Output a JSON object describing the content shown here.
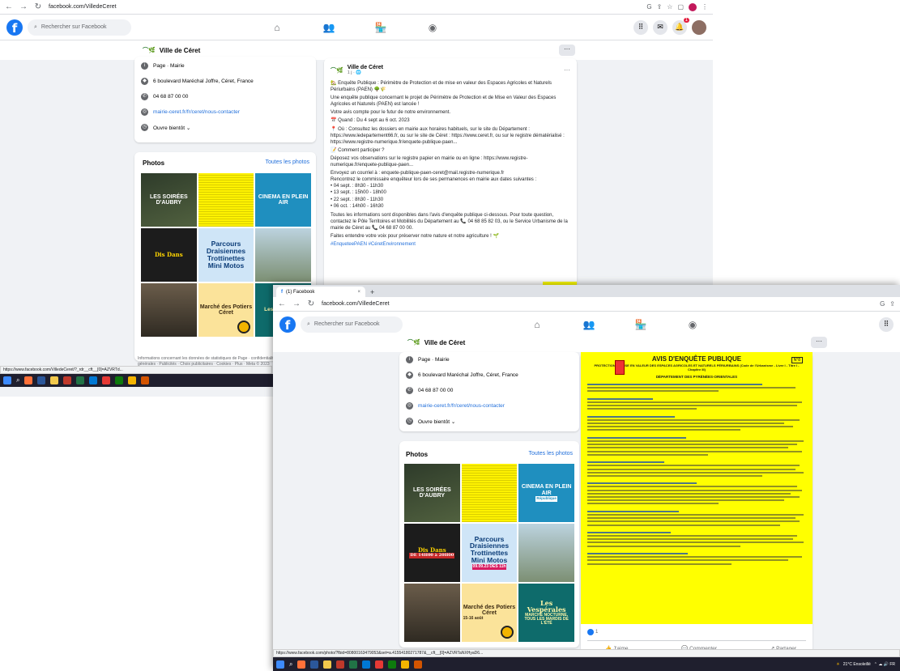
{
  "browser": {
    "url": "facebook.com/VilledeCeret",
    "tab_title": "(1) Facebook",
    "search_placeholder": "Rechercher sur Facebook",
    "new_tab": "+",
    "tab_close": "×"
  },
  "page": {
    "name": "Ville de Céret",
    "more": "···"
  },
  "intro": {
    "category": "Page · Mairie",
    "address": "6 boulevard Maréchal Joffre, Céret, France",
    "phone": "04 68 87 00 00",
    "website": "mairie-ceret.fr/fr/ceret/nous-contacter",
    "hours": "Ouvre bientôt ⌄"
  },
  "photos": {
    "title": "Photos",
    "see_all": "Toutes les photos",
    "tiles": [
      {
        "text": "LES SOIRÉES D'AUBRY",
        "sub": "LES 8 SEPT. 2023"
      },
      {
        "text": "",
        "sub": ""
      },
      {
        "text": "CINEMA EN PLEIN AIR",
        "sub": "République"
      },
      {
        "text": "Dis Dans",
        "sub": "DE 14H00 à 20H00"
      },
      {
        "text": "Parcours Draisiennes Trottinettes Mini Motos",
        "sub": "09.09.23 DES 11h"
      },
      {
        "text": "",
        "sub": ""
      },
      {
        "text": "",
        "sub": ""
      },
      {
        "text": "Marché des Potiers Céret",
        "sub": "15-16 août"
      },
      {
        "text": "Les Vespérales",
        "sub": "MARCHÉ NOCTURNE, TOUS LES MARDIS DE L'ÉTÉ"
      }
    ],
    "footer": "Informations concernant les données de statistiques de Page · confidentialité · Conditions générales · Publicités · Choix publicitaires · Cookies · Plus · Meta © 2023"
  },
  "post": {
    "author": "Ville de Céret",
    "time": "1 j · 🌐",
    "title": "🏡 Enquête Publique : Périmètre de Protection et de mise en valeur des Espaces Agricoles et Naturels Périurbains (PAEN) 🌳🌾",
    "p1": "Une enquête publique concernant le projet de Périmètre de Protection et de Mise en Valeur des Espaces Agricoles et Naturels (PAEN) est lancée !",
    "p2": "Votre avis compte pour le futur de notre environnement.",
    "when": "📅 Quand : Du 4 sept au 6 oct. 2023",
    "where": "📍 Où : Consultez les dossiers en mairie aux horaires habituels, sur le site du Département : https://www.ledepartement66.fr, ou sur le site de Céret : https://www.ceret.fr, ou sur le registre dématérialisé : https://www.registre-numerique.fr/enquete-publique-paen...",
    "how": "📝 Comment participer ?",
    "how1": "Déposez vos observations sur le registre papier en mairie ou en ligne : https://www.registre-numerique.fr/enquete-publique-paen...",
    "how2": "Envoyez un courriel à : enquete-publique-paen-ceret@mail.registre-numerique.fr",
    "how3": "Rencontrez le commissaire enquêteur lors de ses permanences en mairie aux dates suivantes :",
    "dates": [
      "• 04 sept. : 8h30 - 11h30",
      "• 13 sept. : 15h00 - 18h00",
      "• 22 sept. : 8h30 - 11h30",
      "• 06 oct. : 14h00 - 16h30"
    ],
    "p3": "Toutes les informations sont disponibles dans l'avis d'enquête publique ci-dessous. Pour toute question, contactez le Pôle Territoires et Mobilités du Département au 📞 04 68 85 82 03, ou le Service Urbanisme de la mairie de Céret au 📞 04 68 87 00 00.",
    "p4": "Faites entendre votre voix pour préserver notre nature et notre agriculture ! 🌱",
    "hashtags": "#EnqueteePAEN #CéretEnvironnement",
    "reactions": "1",
    "like": "👍 J'aime",
    "comment": "💬 Commenter",
    "share": "↗ Partager"
  },
  "doc": {
    "title": "AVIS D'ENQUÊTE PUBLIQUE",
    "subtitle": "PROTECTION ET MISE EN VALEUR DES ESPACES AGRICOLES ET NATURELS PÉRIURBAINS (Code de l'Urbanisme - Livre I - Titre I - Chapitre III)",
    "heading2": "DÉPARTEMENT DES PYRÉNÉES-ORIENTALES",
    "ref": "N°8"
  },
  "statusbar": {
    "url1": "https://www.facebook.com/VilledeCeret/?_rdr__cft__[0]=AZVRTd...",
    "url2": "https://www.facebook.com/photo/?fbid=80800163479053&set=a.41554180271787&__cft__[0]=AZVRTaNXHyaD6..."
  },
  "taskbar": {
    "weather": "21°C Ensoleillé",
    "time": "⌃ ☁ 🔊 FR"
  },
  "colors": {
    "fb_blue": "#1877f2",
    "doc_yellow": "#ffff00",
    "page_bg": "#f0f2f5"
  }
}
